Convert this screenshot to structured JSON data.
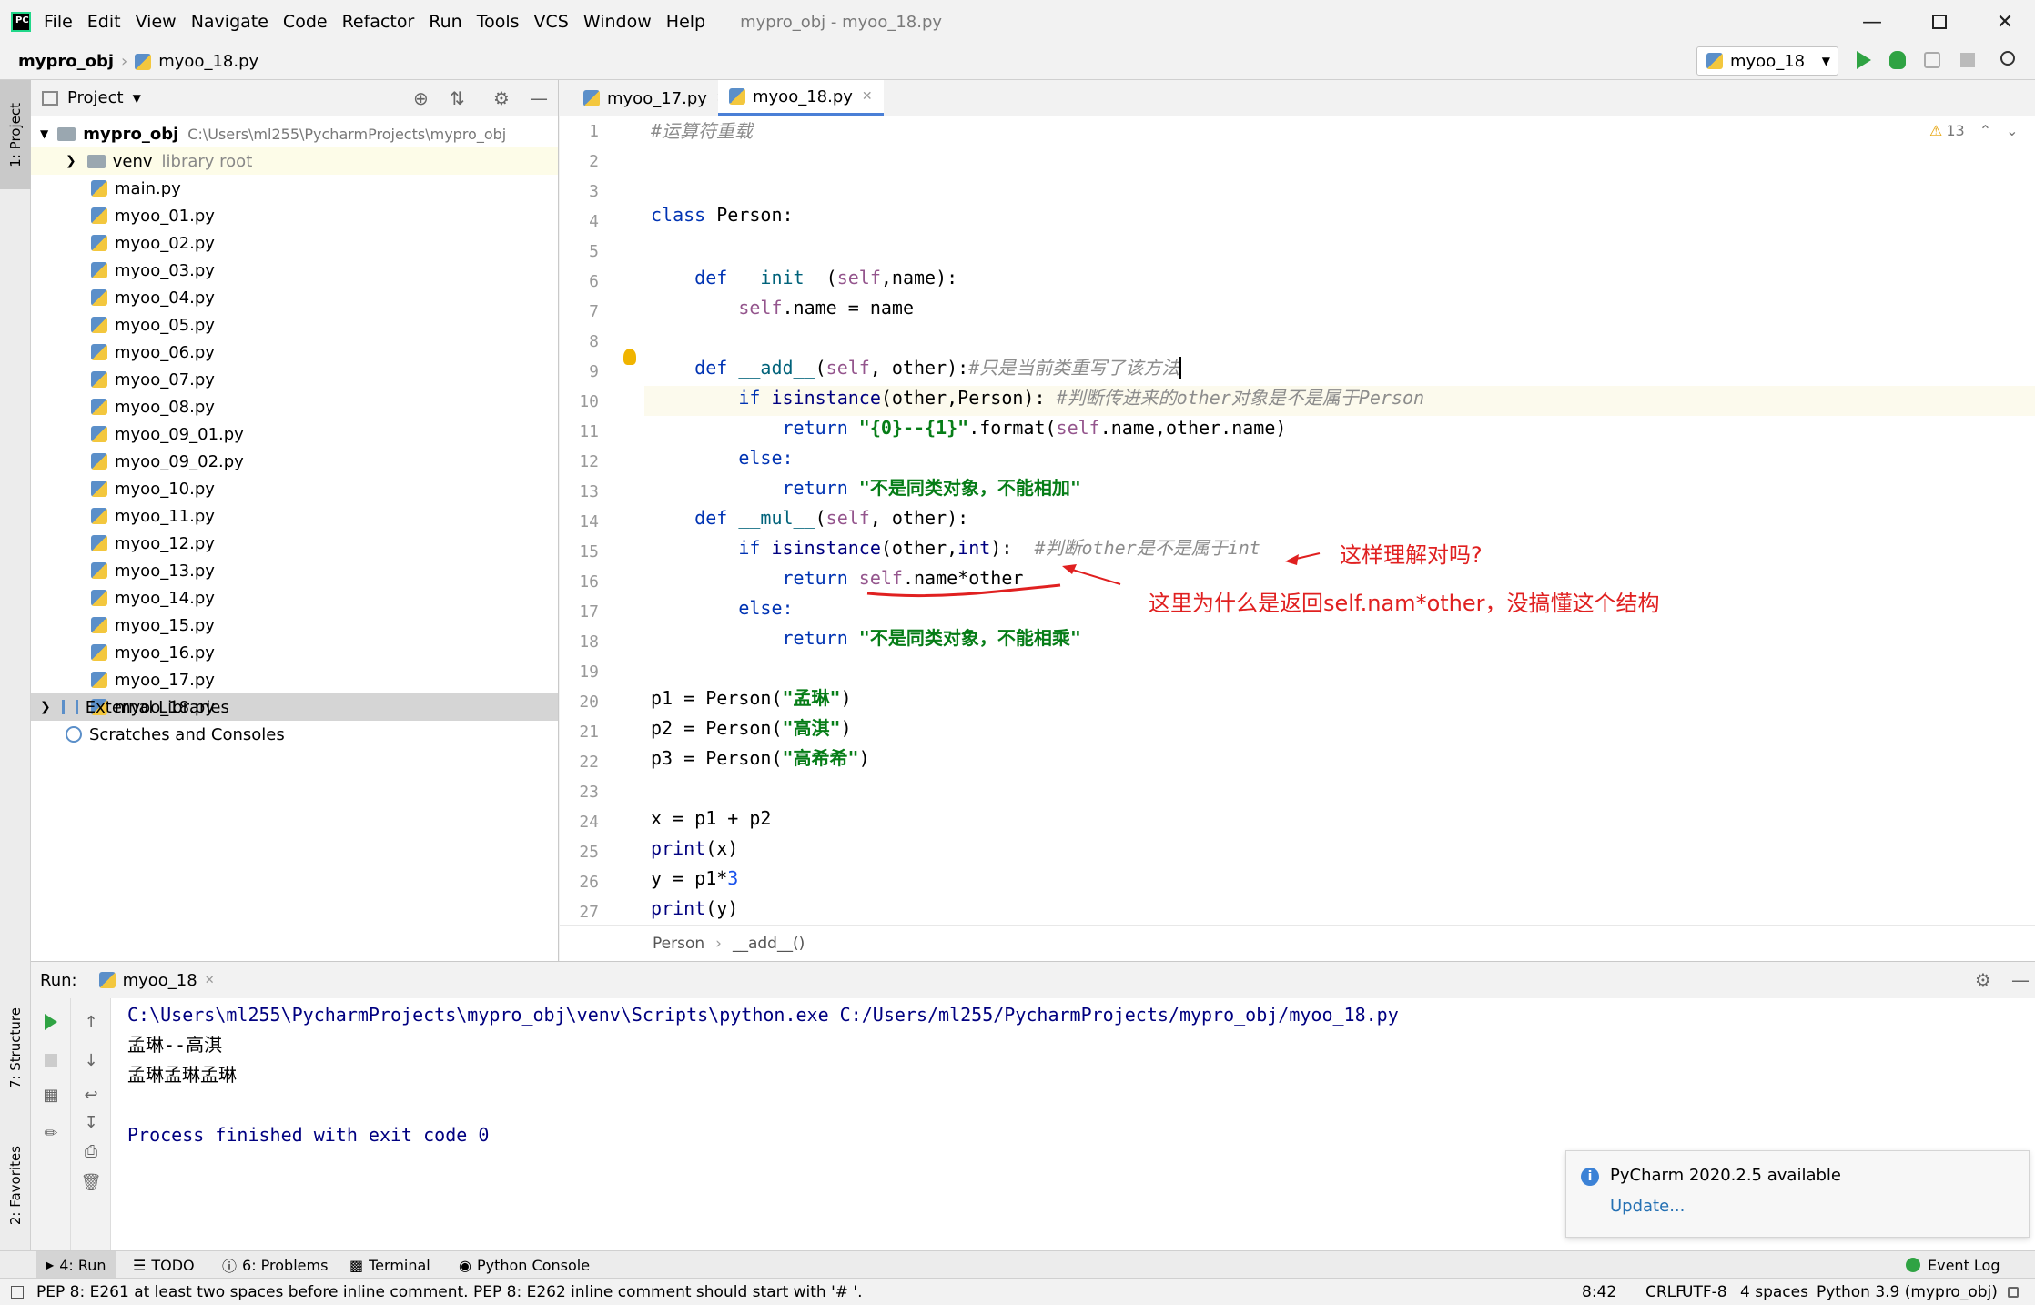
{
  "menubar": {
    "items": [
      "File",
      "Edit",
      "View",
      "Navigate",
      "Code",
      "Refactor",
      "Run",
      "Tools",
      "VCS",
      "Window",
      "Help"
    ],
    "window_title": "mypro_obj - myoo_18.py"
  },
  "navbar": {
    "project": "mypro_obj",
    "file": "myoo_18.py",
    "run_config": "myoo_18"
  },
  "left_stripe": {
    "project_tab": "1: Project",
    "structure_tab": "7: Structure",
    "favorites_tab": "2: Favorites"
  },
  "project_panel": {
    "title": "Project",
    "root_name": "mypro_obj",
    "root_path": "C:\\Users\\ml255\\PycharmProjects\\mypro_obj",
    "venv": "venv",
    "venv_note": "library root",
    "files": [
      "main.py",
      "myoo_01.py",
      "myoo_02.py",
      "myoo_03.py",
      "myoo_04.py",
      "myoo_05.py",
      "myoo_06.py",
      "myoo_07.py",
      "myoo_08.py",
      "myoo_09_01.py",
      "myoo_09_02.py",
      "myoo_10.py",
      "myoo_11.py",
      "myoo_12.py",
      "myoo_13.py",
      "myoo_14.py",
      "myoo_15.py",
      "myoo_16.py",
      "myoo_17.py",
      "myoo_18.py"
    ],
    "external": "External Libraries",
    "scratches": "Scratches and Consoles"
  },
  "editor": {
    "tabs": [
      "myoo_17.py",
      "myoo_18.py"
    ],
    "warnings": "13",
    "line_numbers": [
      "1",
      "2",
      "3",
      "4",
      "5",
      "6",
      "7",
      "8",
      "9",
      "10",
      "11",
      "12",
      "13",
      "14",
      "15",
      "16",
      "17",
      "18",
      "19",
      "20",
      "21",
      "22",
      "23",
      "24",
      "25",
      "26",
      "27"
    ],
    "code": {
      "l1": "#运算符重载",
      "l3a": "class",
      "l3b": " Person:",
      "l5a": "    def ",
      "l5b": "__init__",
      "l5c": "(",
      "l5d": "self",
      "l5e": ",name):",
      "l6a": "        ",
      "l6b": "self",
      "l6c": ".name = name",
      "l8a": "    def ",
      "l8b": "__add__",
      "l8c": "(",
      "l8d": "self",
      "l8e": ", other):",
      "l8f": "#只是当前类重写了该方法",
      "l9a": "        if ",
      "l9b": "isinstance",
      "l9c": "(other,Person): ",
      "l9d": "#判断传进来的other对象是不是属于Person",
      "l10a": "            return ",
      "l10b": "\"{0}--{1}\"",
      "l10c": ".format(",
      "l10d": "self",
      "l10e": ".name,other.name)",
      "l11": "        else:",
      "l12a": "            return ",
      "l12b": "\"不是同类对象，不能相加\"",
      "l13a": "    def ",
      "l13b": "__mul__",
      "l13c": "(",
      "l13d": "self",
      "l13e": ", other):",
      "l14a": "        if ",
      "l14b": "isinstance",
      "l14c": "(other,",
      "l14d": "int",
      "l14e": "):  ",
      "l14f": "#判断other是不是属于int",
      "l15a": "            return ",
      "l15b": "self",
      "l15c": ".name*other",
      "l16": "        else:",
      "l17a": "            return ",
      "l17b": "\"不是同类对象，不能相乘\"",
      "l19a": "p1 = Person(",
      "l19b": "\"孟琳\"",
      "l19c": ")",
      "l20a": "p2 = Person(",
      "l20b": "\"高淇\"",
      "l20c": ")",
      "l21a": "p3 = Person(",
      "l21b": "\"高希希\"",
      "l21c": ")",
      "l23": "x = p1 + p2",
      "l24a": "print",
      "l24b": "(x)",
      "l26a": "y = p1*",
      "l26b": "3",
      "l27a": "print",
      "l27b": "(y)"
    },
    "annotation1": "这样理解对吗?",
    "annotation2": "这里为什么是返回self.nam*other，没搞懂这个结构",
    "breadcrumb": [
      "Person",
      "__add__()"
    ]
  },
  "run_panel": {
    "label": "Run:",
    "tab": "myoo_18",
    "lines": [
      "C:\\Users\\ml255\\PycharmProjects\\mypro_obj\\venv\\Scripts\\python.exe C:/Users/ml255/PycharmProjects/mypro_obj/myoo_18.py",
      "孟琳--高淇",
      "孟琳孟琳孟琳",
      "Process finished with exit code 0"
    ]
  },
  "notification": {
    "title": "PyCharm 2020.2.5 available",
    "link": "Update..."
  },
  "bottom_tabs": [
    "4: Run",
    "TODO",
    "6: Problems",
    "Terminal",
    "Python Console"
  ],
  "event_log": "Event Log",
  "status": {
    "message": "PEP 8: E261 at least two spaces before inline comment. PEP 8: E262 inline comment should start with '# '.",
    "position": "8:42",
    "line_sep": "CRLF",
    "encoding": "UTF-8",
    "indent": "4 spaces",
    "interpreter": "Python 3.9 (mypro_obj)"
  },
  "colors": {
    "accent": "#4a7fd6",
    "keyword": "#0033b3",
    "self": "#94558d",
    "string": "#067d17",
    "annotation": "#e02020",
    "run_green": "#2fa343"
  }
}
